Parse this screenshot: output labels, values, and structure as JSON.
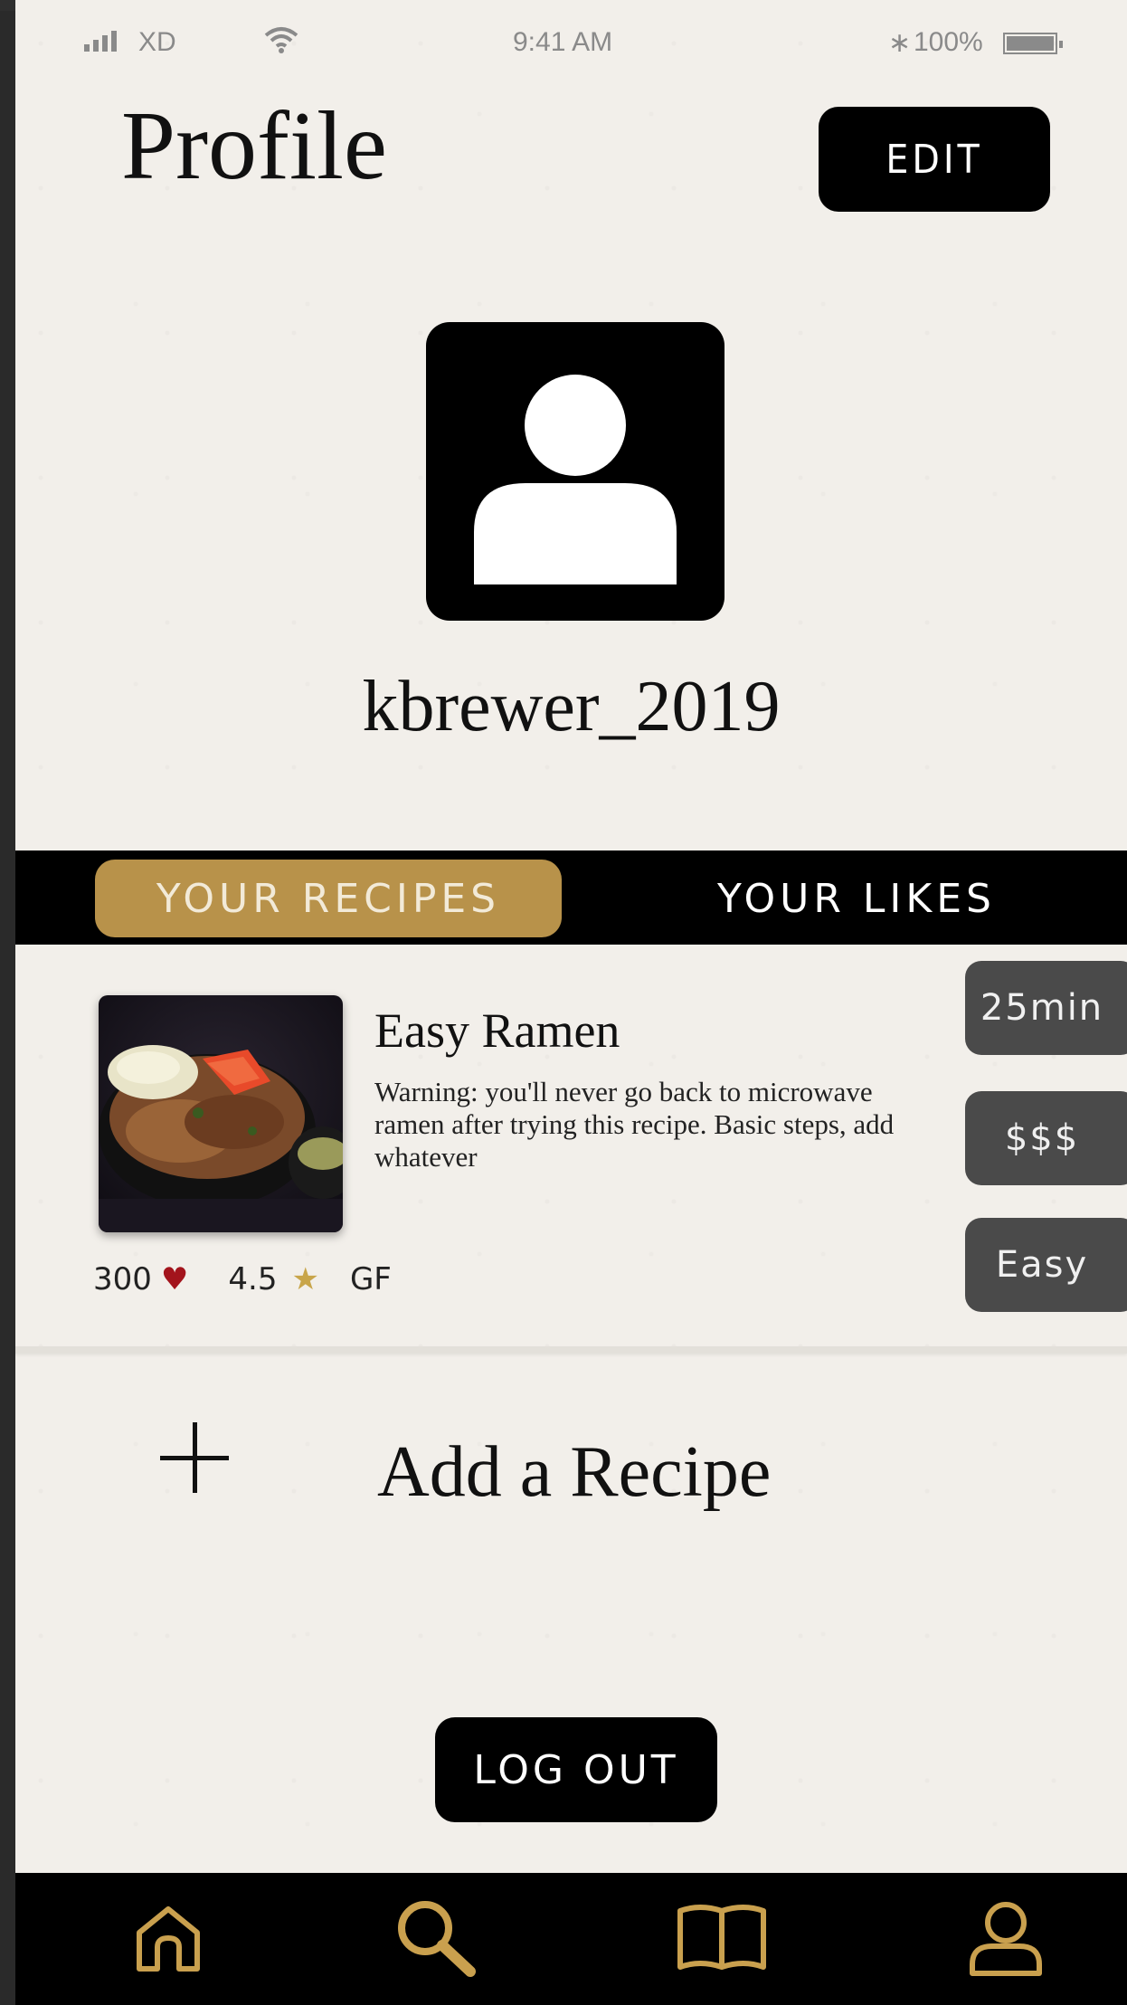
{
  "status_bar": {
    "carrier": "XD",
    "time": "9:41 AM",
    "battery": "100%"
  },
  "header": {
    "title": "Profile",
    "edit_label": "EDIT"
  },
  "profile": {
    "avatar_icon": "user-avatar-icon",
    "username": "kbrewer_2019"
  },
  "tabs": [
    {
      "label": "YOUR RECIPES",
      "active": true
    },
    {
      "label": "YOUR LIKES",
      "active": false
    }
  ],
  "recipe": {
    "title": "Easy Ramen",
    "description": "Warning: you'll never go back to microwave ramen after trying this recipe. Basic steps, add whatever",
    "likes": "300",
    "rating": "4.5",
    "diet": "GF",
    "time": "25min",
    "price": "$$$",
    "difficulty": "Easy"
  },
  "add_recipe": {
    "label": "Add a Recipe"
  },
  "logout_label": "LOG OUT",
  "nav": [
    {
      "icon": "home-icon"
    },
    {
      "icon": "search-icon"
    },
    {
      "icon": "book-icon"
    },
    {
      "icon": "user-icon"
    }
  ],
  "colors": {
    "accent": "#b8924a",
    "background": "#f2efea",
    "chip": "#4a4a4a",
    "heart": "#a3141c",
    "star": "#c8a54a"
  }
}
